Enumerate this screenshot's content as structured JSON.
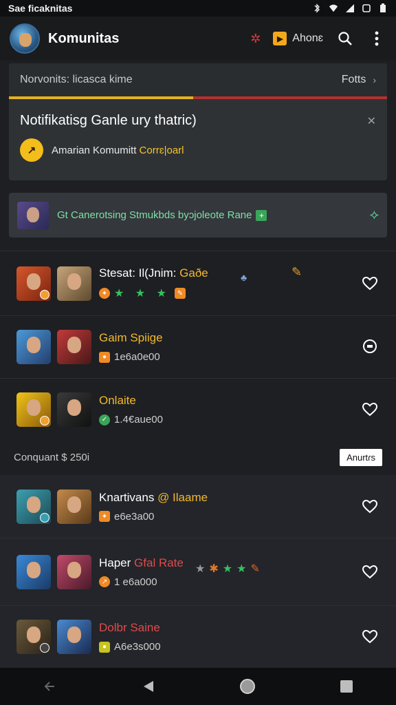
{
  "status": {
    "left_text": "Sae ficaknitas"
  },
  "appbar": {
    "title": "Komunitas",
    "account_label": "Ahonɛ",
    "badge_letter": "▶"
  },
  "card1": {
    "header": "Norvonits: licasca kime",
    "header_right": "Fotts",
    "title": "Notifikatisg Ganle ury thatric)",
    "row_text": "Amarian Komumitt ",
    "row_accent": "Corrɛ|oarl"
  },
  "card2": {
    "text": "Gt Canerotsing Stmukbds byɔjoleote Rane"
  },
  "list1": [
    {
      "name": "Stesat: Il(Jnim:",
      "name_accent": "Gaðe",
      "accent": "y",
      "meta": "",
      "stars": "★ ★ ★",
      "heart": "heart"
    },
    {
      "name": "",
      "name_accent": "Gaim Spiige",
      "accent": "y",
      "meta": "1e6a0e00",
      "stars": "",
      "heart": "chat"
    },
    {
      "name": "",
      "name_accent": "Onlaite",
      "accent": "y",
      "meta": "1.4€aue00",
      "stars": "",
      "heart": "heart"
    }
  ],
  "section": {
    "label": "Conquant $ 250i",
    "button": "Anurtɾs"
  },
  "list2": [
    {
      "name": "Knartivans",
      "name_accent": "@ Ilaame",
      "accent": "y",
      "meta": "e6e3a00",
      "stars": "",
      "heart": "heart"
    },
    {
      "name": "Haper",
      "name_accent": "Gfal Rate",
      "accent": "r",
      "meta": "1 e6a000",
      "stars": "",
      "heart": "heart"
    },
    {
      "name": "",
      "name_accent": "Dolbr Saine",
      "accent": "r",
      "meta": "A6e3s000",
      "stars": "",
      "heart": "heart"
    }
  ]
}
